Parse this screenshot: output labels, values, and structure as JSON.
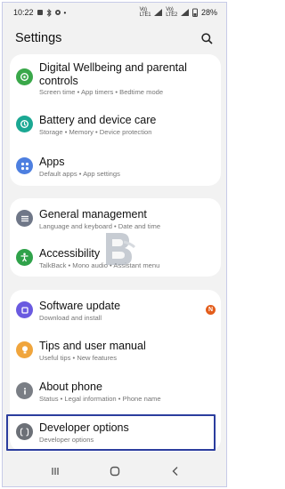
{
  "status_bar": {
    "time": "10:22",
    "battery": "28%"
  },
  "header": {
    "title": "Settings"
  },
  "groups": [
    {
      "items": [
        {
          "title": "Digital Wellbeing and parental controls",
          "subtitle": "Screen time  •  App timers  •  Bedtime mode",
          "icon": "digital-wellbeing-icon",
          "color": "#3aa84a"
        },
        {
          "title": "Battery and device care",
          "subtitle": "Storage  •  Memory  •  Device protection",
          "icon": "device-care-icon",
          "color": "#1ba893"
        },
        {
          "title": "Apps",
          "subtitle": "Default apps  •  App settings",
          "icon": "apps-icon",
          "color": "#4d7fe0"
        }
      ]
    },
    {
      "items": [
        {
          "title": "General management",
          "subtitle": "Language and keyboard  •  Date and time",
          "icon": "general-management-icon",
          "color": "#6f7788"
        },
        {
          "title": "Accessibility",
          "subtitle": "TalkBack  •  Mono audio  •  Assistant menu",
          "icon": "accessibility-icon",
          "color": "#2fa24a"
        }
      ]
    },
    {
      "items": [
        {
          "title": "Software update",
          "subtitle": "Download and install",
          "icon": "software-update-icon",
          "color": "#6a5ae0",
          "badge": "N"
        },
        {
          "title": "Tips and user manual",
          "subtitle": "Useful tips  •  New features",
          "icon": "tips-icon",
          "color": "#f0a53c"
        },
        {
          "title": "About phone",
          "subtitle": "Status  •  Legal information  •  Phone name",
          "icon": "about-phone-icon",
          "color": "#7a7e85"
        },
        {
          "title": "Developer options",
          "subtitle": "Developer options",
          "icon": "developer-options-icon",
          "color": "#6c7077"
        }
      ]
    }
  ],
  "colors": {
    "background": "#f2f2f2",
    "card": "#ffffff",
    "highlight": "#2b3d9e",
    "badge": "#e35d1b"
  }
}
